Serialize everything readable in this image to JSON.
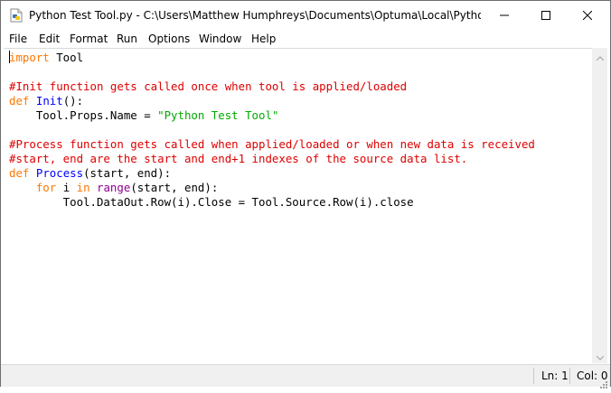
{
  "window": {
    "title": "Python Test Tool.py - C:\\Users\\Matthew Humphreys\\Documents\\Optuma\\Local\\Python Scri...",
    "app_icon": "python-file-icon",
    "controls": [
      "minimize-icon",
      "maximize-icon",
      "close-icon"
    ]
  },
  "menu": {
    "items": [
      {
        "label": "File"
      },
      {
        "label": "Edit"
      },
      {
        "label": "Format"
      },
      {
        "label": "Run"
      },
      {
        "label": "Options"
      },
      {
        "label": "Window"
      },
      {
        "label": "Help"
      }
    ]
  },
  "editor": {
    "lines": [
      [
        {
          "t": "import",
          "c": "kw"
        },
        {
          "t": " Tool",
          "c": ""
        }
      ],
      [],
      [
        {
          "t": "#Init function gets called once when tool is applied/loaded",
          "c": "cm"
        }
      ],
      [
        {
          "t": "def",
          "c": "kw"
        },
        {
          "t": " ",
          "c": ""
        },
        {
          "t": "Init",
          "c": "fn"
        },
        {
          "t": "():",
          "c": ""
        }
      ],
      [
        {
          "t": "    Tool.Props.Name = ",
          "c": ""
        },
        {
          "t": "\"Python Test Tool\"",
          "c": "str"
        }
      ],
      [],
      [
        {
          "t": "#Process function gets called when applied/loaded or when new data is received",
          "c": "cm"
        }
      ],
      [
        {
          "t": "#start, end are the start and end+1 indexes of the source data list.",
          "c": "cm"
        }
      ],
      [
        {
          "t": "def",
          "c": "kw"
        },
        {
          "t": " ",
          "c": ""
        },
        {
          "t": "Process",
          "c": "fn"
        },
        {
          "t": "(start, end):",
          "c": ""
        }
      ],
      [
        {
          "t": "    ",
          "c": ""
        },
        {
          "t": "for",
          "c": "kw"
        },
        {
          "t": " i ",
          "c": ""
        },
        {
          "t": "in",
          "c": "kw"
        },
        {
          "t": " ",
          "c": ""
        },
        {
          "t": "range",
          "c": "bi"
        },
        {
          "t": "(start, end):",
          "c": ""
        }
      ],
      [
        {
          "t": "        Tool.DataOut.Row(i).Close = Tool.Source.Row(i).close",
          "c": ""
        }
      ]
    ],
    "colors": {
      "keyword": "#ff7700",
      "definition": "#0000ff",
      "builtin": "#900090",
      "string": "#00aa00",
      "comment": "#dd0000"
    }
  },
  "status": {
    "line": "Ln: 1",
    "col": "Col: 0"
  }
}
